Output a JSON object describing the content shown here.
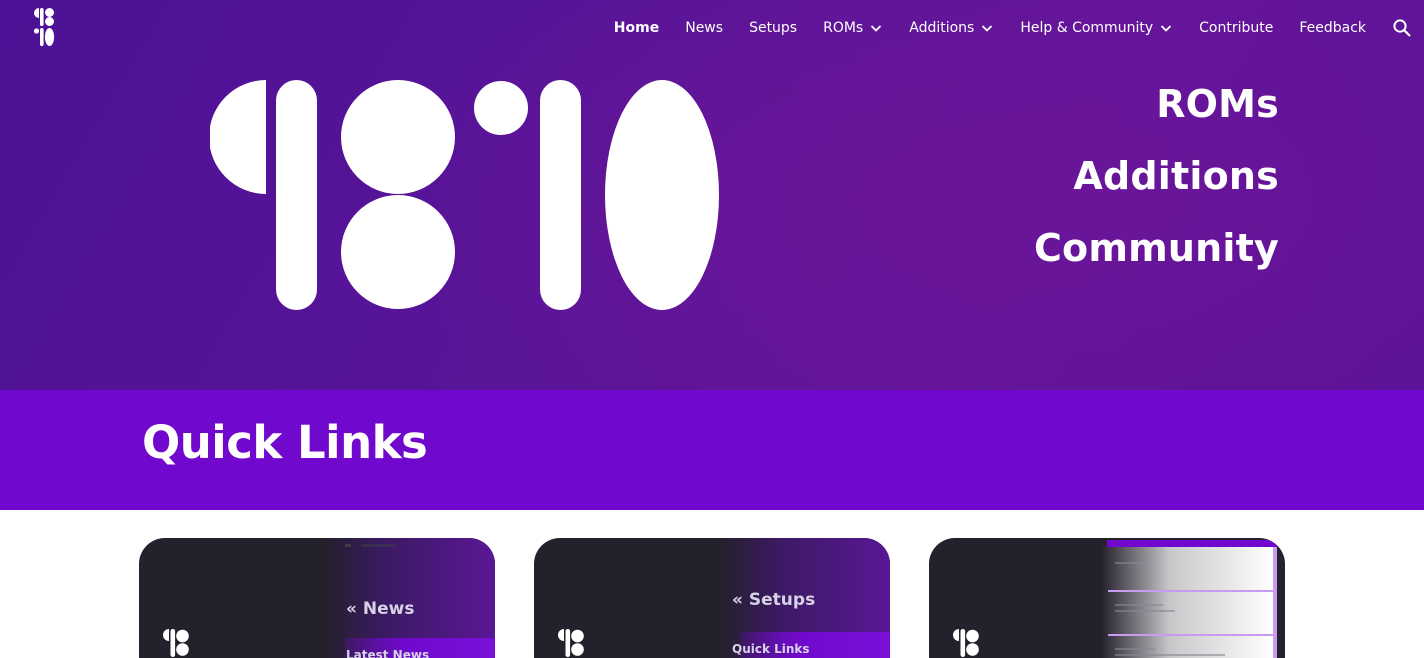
{
  "header": {
    "logo_name": "logo-1810",
    "nav": [
      {
        "label": "Home",
        "active": true,
        "dropdown": false
      },
      {
        "label": "News",
        "active": false,
        "dropdown": false
      },
      {
        "label": "Setups",
        "active": false,
        "dropdown": false
      },
      {
        "label": "ROMs",
        "active": false,
        "dropdown": true
      },
      {
        "label": "Additions",
        "active": false,
        "dropdown": true
      },
      {
        "label": "Help & Community",
        "active": false,
        "dropdown": true
      },
      {
        "label": "Contribute",
        "active": false,
        "dropdown": false
      },
      {
        "label": "Feedback",
        "active": false,
        "dropdown": false
      }
    ],
    "search_icon": "search-icon"
  },
  "hero": {
    "mark": "1810",
    "words": [
      "ROMs",
      "Additions",
      "Community"
    ]
  },
  "quick_links": {
    "title": "Quick Links",
    "cards": [
      {
        "heading": "« News",
        "sub": "Latest News"
      },
      {
        "heading": "« Setups",
        "sub": "Quick Links"
      },
      {
        "heading": "",
        "sub": ""
      }
    ]
  },
  "colors": {
    "hero_start": "#4c1196",
    "hero_end": "#63159a",
    "band": "#7009cd",
    "card_dark": "#24202c",
    "text": "#ffffff"
  }
}
